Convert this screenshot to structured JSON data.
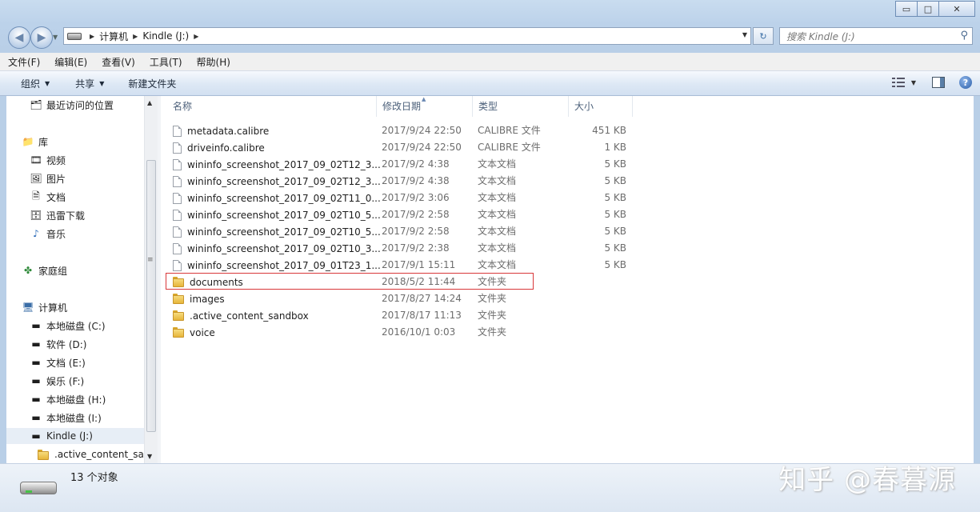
{
  "window": {
    "minimize": "▭",
    "maximize": "□",
    "close": "✕"
  },
  "address": {
    "segments": [
      "计算机",
      "Kindle (J:)"
    ],
    "refresh_icon": "↻"
  },
  "search": {
    "placeholder": "搜索 Kindle (J:)"
  },
  "menu": [
    "文件(F)",
    "编辑(E)",
    "查看(V)",
    "工具(T)",
    "帮助(H)"
  ],
  "toolbar": {
    "organize": "组织",
    "share": "共享",
    "new_folder": "新建文件夹",
    "help": "?"
  },
  "nav": {
    "items": [
      {
        "label": "最近访问的位置",
        "icon": "recent-places-icon"
      },
      {
        "label": "库",
        "icon": "library-icon"
      },
      {
        "label": "视频",
        "icon": "video-library-icon"
      },
      {
        "label": "图片",
        "icon": "pictures-library-icon"
      },
      {
        "label": "文档",
        "icon": "documents-library-icon"
      },
      {
        "label": "迅雷下载",
        "icon": "download-library-icon"
      },
      {
        "label": "音乐",
        "icon": "music-library-icon"
      },
      {
        "label": "家庭组",
        "icon": "homegroup-icon"
      },
      {
        "label": "计算机",
        "icon": "computer-icon"
      },
      {
        "label": "本地磁盘 (C:)",
        "icon": "system-drive-icon"
      },
      {
        "label": "软件 (D:)",
        "icon": "drive-icon"
      },
      {
        "label": "文档 (E:)",
        "icon": "drive-icon"
      },
      {
        "label": "娱乐 (F:)",
        "icon": "drive-icon"
      },
      {
        "label": "本地磁盘 (H:)",
        "icon": "drive-icon"
      },
      {
        "label": "本地磁盘 (I:)",
        "icon": "drive-icon"
      },
      {
        "label": "Kindle (J:)",
        "icon": "removable-drive-icon"
      },
      {
        "label": ".active_content_san",
        "icon": "folder-icon"
      }
    ]
  },
  "columns": [
    "名称",
    "修改日期",
    "类型",
    "大小"
  ],
  "files": [
    {
      "name": "metadata.calibre",
      "date": "2017/9/24 22:50",
      "type": "CALIBRE 文件",
      "size": "451 KB",
      "kind": "file"
    },
    {
      "name": "driveinfo.calibre",
      "date": "2017/9/24 22:50",
      "type": "CALIBRE 文件",
      "size": "1 KB",
      "kind": "file"
    },
    {
      "name": "wininfo_screenshot_2017_09_02T12_3...",
      "date": "2017/9/2 4:38",
      "type": "文本文档",
      "size": "5 KB",
      "kind": "file"
    },
    {
      "name": "wininfo_screenshot_2017_09_02T12_3...",
      "date": "2017/9/2 4:38",
      "type": "文本文档",
      "size": "5 KB",
      "kind": "file"
    },
    {
      "name": "wininfo_screenshot_2017_09_02T11_0...",
      "date": "2017/9/2 3:06",
      "type": "文本文档",
      "size": "5 KB",
      "kind": "file"
    },
    {
      "name": "wininfo_screenshot_2017_09_02T10_5...",
      "date": "2017/9/2 2:58",
      "type": "文本文档",
      "size": "5 KB",
      "kind": "file"
    },
    {
      "name": "wininfo_screenshot_2017_09_02T10_5...",
      "date": "2017/9/2 2:58",
      "type": "文本文档",
      "size": "5 KB",
      "kind": "file"
    },
    {
      "name": "wininfo_screenshot_2017_09_02T10_3...",
      "date": "2017/9/2 2:38",
      "type": "文本文档",
      "size": "5 KB",
      "kind": "file"
    },
    {
      "name": "wininfo_screenshot_2017_09_01T23_1...",
      "date": "2017/9/1 15:11",
      "type": "文本文档",
      "size": "5 KB",
      "kind": "file"
    },
    {
      "name": "documents",
      "date": "2018/5/2 11:44",
      "type": "文件夹",
      "size": "",
      "kind": "folder"
    },
    {
      "name": "images",
      "date": "2017/8/27 14:24",
      "type": "文件夹",
      "size": "",
      "kind": "folder"
    },
    {
      "name": ".active_content_sandbox",
      "date": "2017/8/17 11:13",
      "type": "文件夹",
      "size": "",
      "kind": "folder"
    },
    {
      "name": "voice",
      "date": "2016/10/1 0:03",
      "type": "文件夹",
      "size": "",
      "kind": "folder"
    }
  ],
  "status": {
    "count": "13 个对象",
    "watermark": "知乎 @春暮源"
  },
  "colors": {
    "highlight": "#d9373a",
    "selected_nav": "#e7eef6"
  }
}
